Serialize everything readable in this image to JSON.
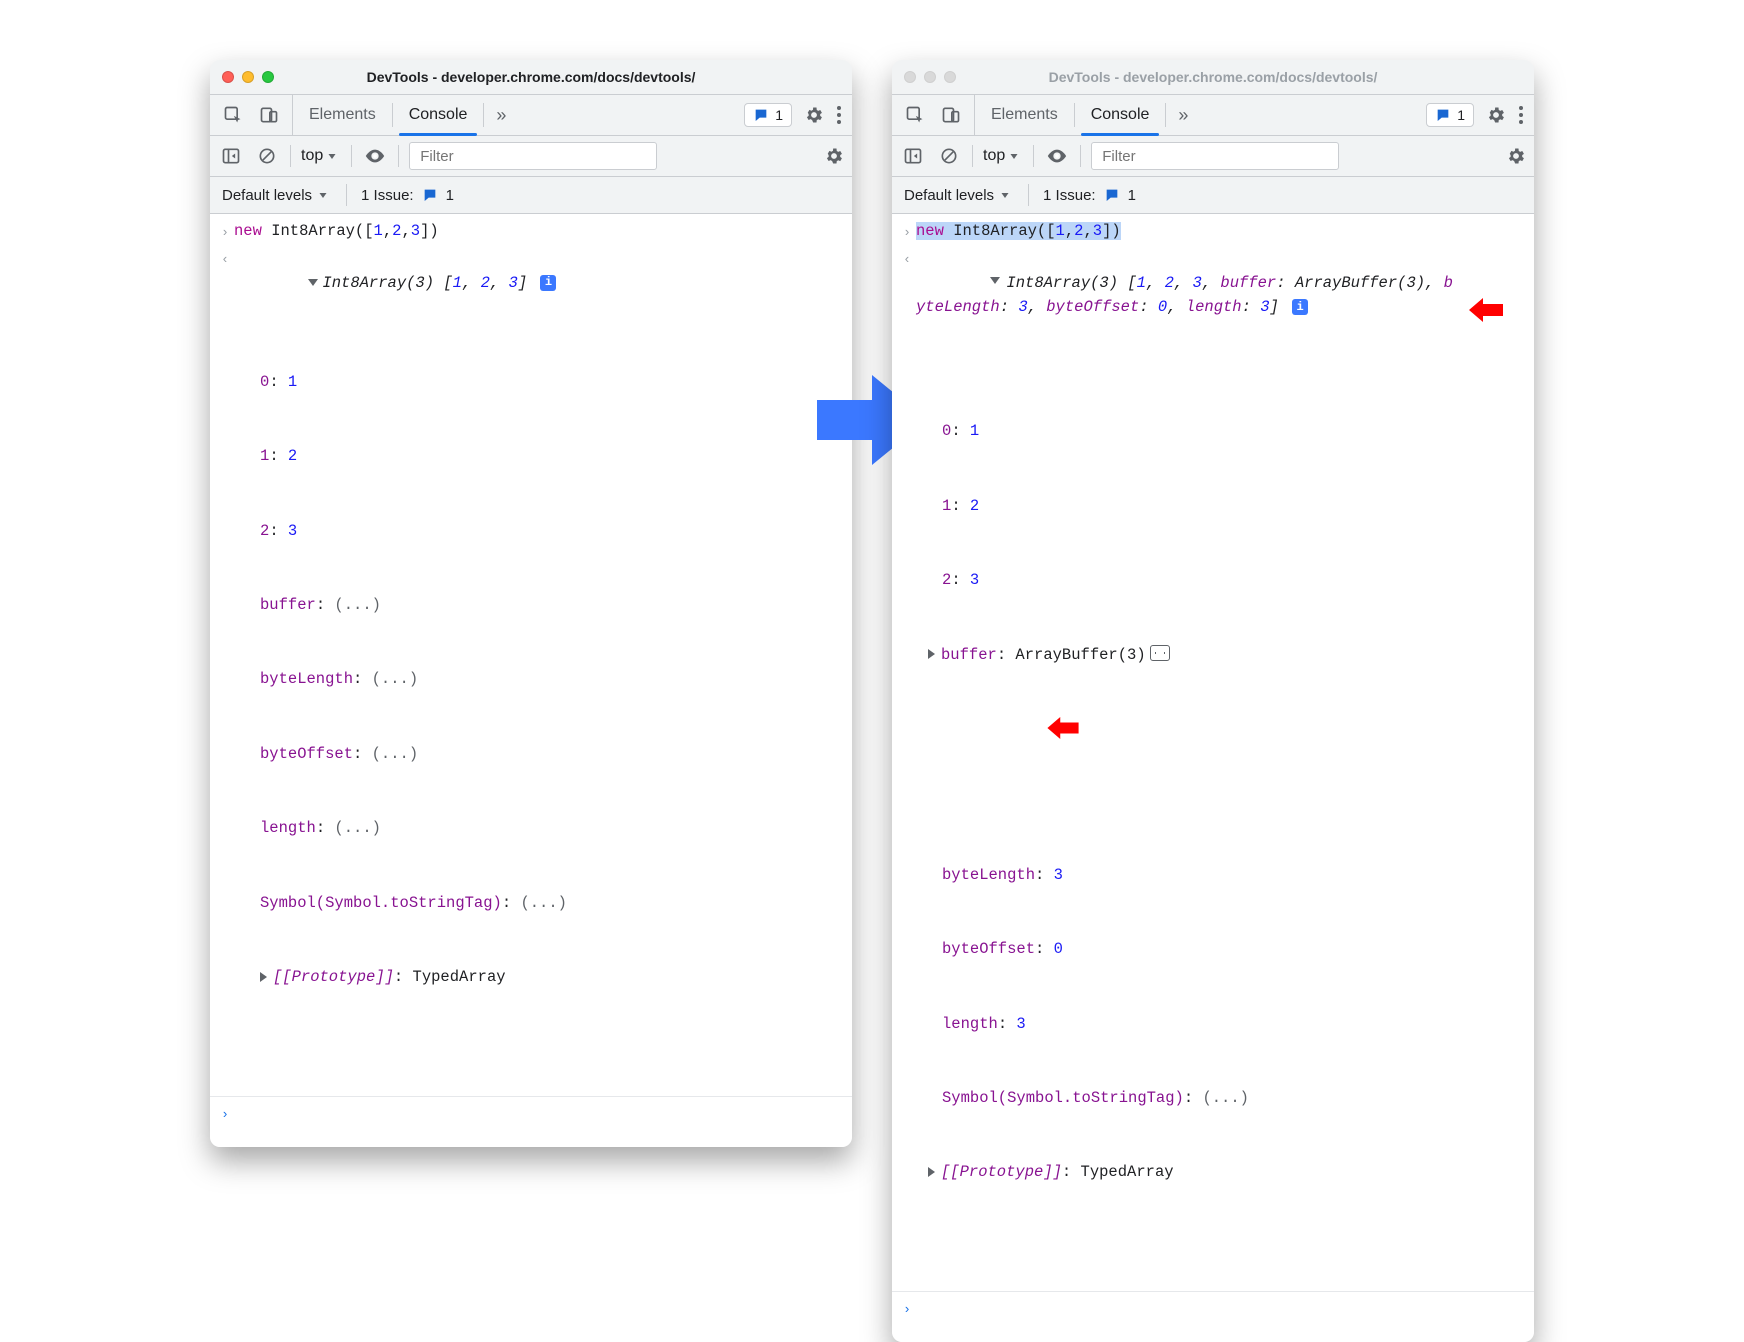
{
  "title": "DevTools - developer.chrome.com/docs/devtools/",
  "tabs": {
    "elements": "Elements",
    "console": "Console",
    "more": "»"
  },
  "issues_count": "1",
  "filter": {
    "context": "top",
    "placeholder": "Filter",
    "levels": "Default levels",
    "issue_label": "1 Issue:",
    "issue_count": "1"
  },
  "left": {
    "input": "new Int8Array([1,2,3])",
    "summary_pre": "Int8Array(3) ",
    "summary_arr": "[1, 2, 3]",
    "props": {
      "i0k": "0",
      "i0v": "1",
      "i1k": "1",
      "i1v": "2",
      "i2k": "2",
      "i2v": "3",
      "buffer": "buffer",
      "buffer_v": "(...)",
      "byteLength": "byteLength",
      "byteLength_v": "(...)",
      "byteOffset": "byteOffset",
      "byteOffset_v": "(...)",
      "length": "length",
      "length_v": "(...)",
      "symbol": "Symbol(Symbol.toStringTag)",
      "symbol_v": "(...)",
      "proto": "[[Prototype]]",
      "proto_v": "TypedArray"
    }
  },
  "right": {
    "input": "new Int8Array([1,2,3])",
    "summary_a": "Int8Array(3) ",
    "summary_b": "[1, 2, 3, ",
    "summary_c": "buffer",
    "summary_d": ": ArrayBuffer(3), b",
    "summary_e": "yteLength",
    "summary_f": ": 3, ",
    "summary_g": "byteOffset",
    "summary_h": ": 0, ",
    "summary_i": "length",
    "summary_j": ": 3]",
    "props": {
      "i0k": "0",
      "i0v": "1",
      "i1k": "1",
      "i1v": "2",
      "i2k": "2",
      "i2v": "3",
      "buffer": "buffer",
      "buffer_v": "ArrayBuffer(3)",
      "byteLength": "byteLength",
      "byteLength_v": "3",
      "byteOffset": "byteOffset",
      "byteOffset_v": "0",
      "length": "length",
      "length_v": "3",
      "symbol": "Symbol(Symbol.toStringTag)",
      "symbol_v": "(...)",
      "proto": "[[Prototype]]",
      "proto_v": "TypedArray"
    }
  }
}
